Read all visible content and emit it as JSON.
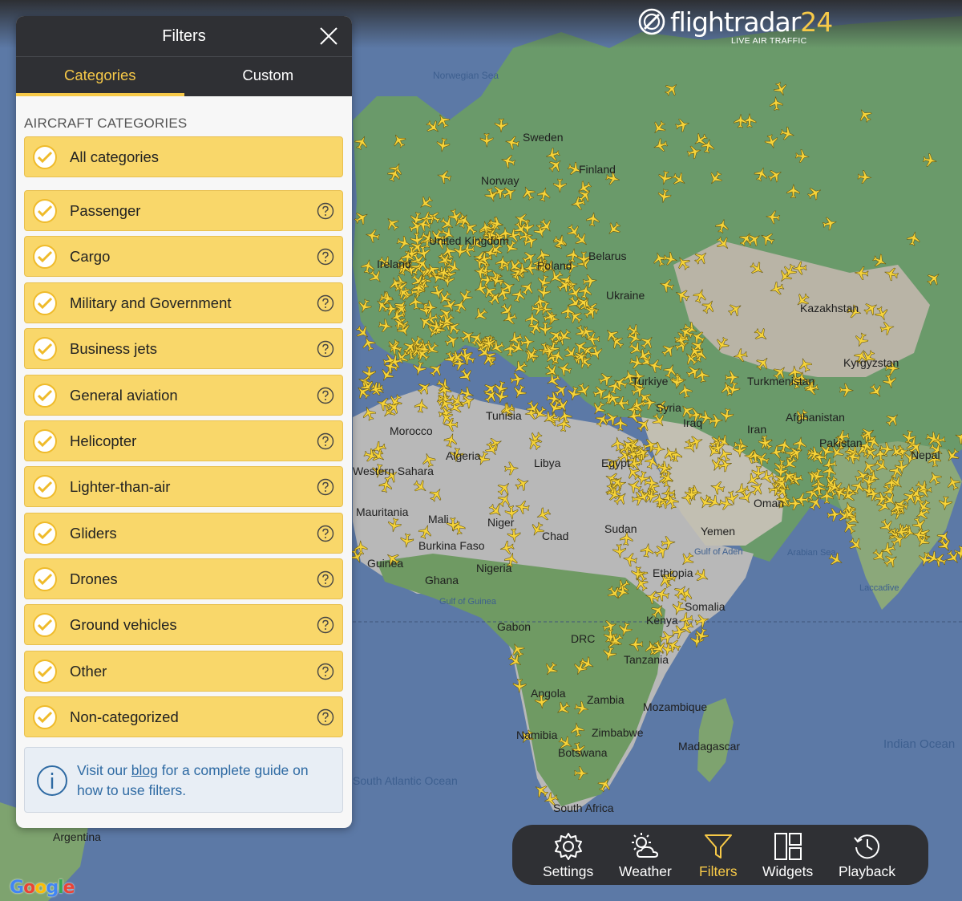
{
  "brand": {
    "name_text": "flightradar",
    "name_number": "24",
    "tagline": "LIVE AIR TRAFFIC",
    "accent_color": "#f7c948"
  },
  "filters_panel": {
    "title": "Filters",
    "close_icon": "close-icon",
    "tabs": [
      {
        "label": "Categories",
        "active": true
      },
      {
        "label": "Custom",
        "active": false
      }
    ],
    "section_title": "AIRCRAFT CATEGORIES",
    "all_categories": {
      "label": "All categories",
      "checked": true
    },
    "categories": [
      {
        "label": "Passenger",
        "checked": true
      },
      {
        "label": "Cargo",
        "checked": true
      },
      {
        "label": "Military and Government",
        "checked": true
      },
      {
        "label": "Business jets",
        "checked": true
      },
      {
        "label": "General aviation",
        "checked": true
      },
      {
        "label": "Helicopter",
        "checked": true
      },
      {
        "label": "Lighter-than-air",
        "checked": true
      },
      {
        "label": "Gliders",
        "checked": true
      },
      {
        "label": "Drones",
        "checked": true
      },
      {
        "label": "Ground vehicles",
        "checked": true
      },
      {
        "label": "Other",
        "checked": true
      },
      {
        "label": "Non-categorized",
        "checked": true
      }
    ],
    "info": {
      "text_before": "Visit our ",
      "link_text": "blog",
      "text_after": " for a complete guide on how to use filters."
    }
  },
  "toolbar": {
    "items": [
      {
        "label": "Settings",
        "icon": "gear-icon",
        "active": false
      },
      {
        "label": "Weather",
        "icon": "weather-icon",
        "active": false
      },
      {
        "label": "Filters",
        "icon": "filter-icon",
        "active": true
      },
      {
        "label": "Widgets",
        "icon": "widgets-icon",
        "active": false
      },
      {
        "label": "Playback",
        "icon": "history-icon",
        "active": false
      }
    ]
  },
  "map": {
    "labels": [
      {
        "text": "Norwegian Sea"
      },
      {
        "text": "Sweden"
      },
      {
        "text": "Finland"
      },
      {
        "text": "Norway"
      },
      {
        "text": "United Kingdom"
      },
      {
        "text": "Ireland"
      },
      {
        "text": "Poland"
      },
      {
        "text": "Belarus"
      },
      {
        "text": "Ukraine"
      },
      {
        "text": "Kazakhstan"
      },
      {
        "text": "Kyrgyzstan"
      },
      {
        "text": "Turkmenistan"
      },
      {
        "text": "Turkiye"
      },
      {
        "text": "Syria"
      },
      {
        "text": "Iraq"
      },
      {
        "text": "Iran"
      },
      {
        "text": "Afghanistan"
      },
      {
        "text": "Pakistan"
      },
      {
        "text": "Nepal"
      },
      {
        "text": "Tunisia"
      },
      {
        "text": "Morocco"
      },
      {
        "text": "Algeria"
      },
      {
        "text": "Libya"
      },
      {
        "text": "Egypt"
      },
      {
        "text": "Western Sahara"
      },
      {
        "text": "Mauritania"
      },
      {
        "text": "Mali"
      },
      {
        "text": "Niger"
      },
      {
        "text": "Chad"
      },
      {
        "text": "Sudan"
      },
      {
        "text": "Yemen"
      },
      {
        "text": "Oman"
      },
      {
        "text": "Gulf of Aden"
      },
      {
        "text": "Arabian Sea"
      },
      {
        "text": "Burkina Faso"
      },
      {
        "text": "Guinea"
      },
      {
        "text": "Ghana"
      },
      {
        "text": "Nigeria"
      },
      {
        "text": "Gulf of Guinea"
      },
      {
        "text": "Ethiopia"
      },
      {
        "text": "Somalia"
      },
      {
        "text": "Kenya"
      },
      {
        "text": "Gabon"
      },
      {
        "text": "DRC"
      },
      {
        "text": "Tanzania"
      },
      {
        "text": "Angola"
      },
      {
        "text": "Zambia"
      },
      {
        "text": "Mozambique"
      },
      {
        "text": "Namibia"
      },
      {
        "text": "Zimbabwe"
      },
      {
        "text": "Botswana"
      },
      {
        "text": "Madagascar"
      },
      {
        "text": "South Africa"
      },
      {
        "text": "Indian Ocean"
      },
      {
        "text": "Laccadive"
      },
      {
        "text": "South Atlantic Ocean"
      },
      {
        "text": "Argentina"
      }
    ],
    "attribution": "Google"
  }
}
